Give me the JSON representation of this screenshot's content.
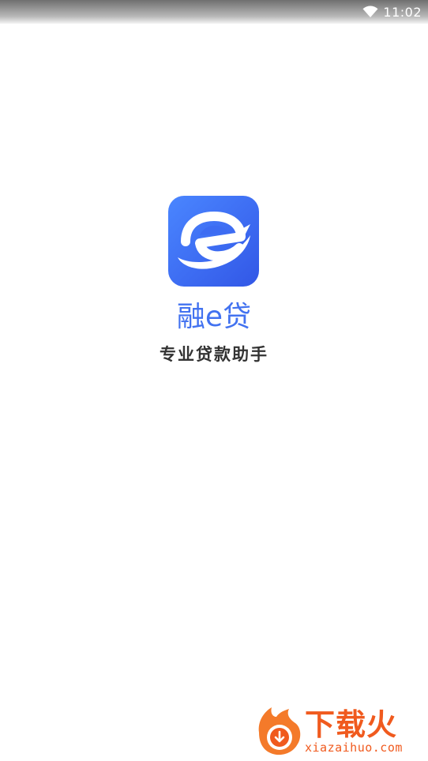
{
  "status_bar": {
    "time": "11:02",
    "icons": [
      "wifi-icon"
    ]
  },
  "splash": {
    "app_icon": "app-logo-e-icon",
    "app_name": "融e贷",
    "slogan": "专业贷款助手",
    "brand_color": "#4272f0"
  },
  "watermark": {
    "logo": "flame-icon",
    "title": "下载火",
    "url": "xiazaihuo.com",
    "color": "#f05a1e"
  }
}
